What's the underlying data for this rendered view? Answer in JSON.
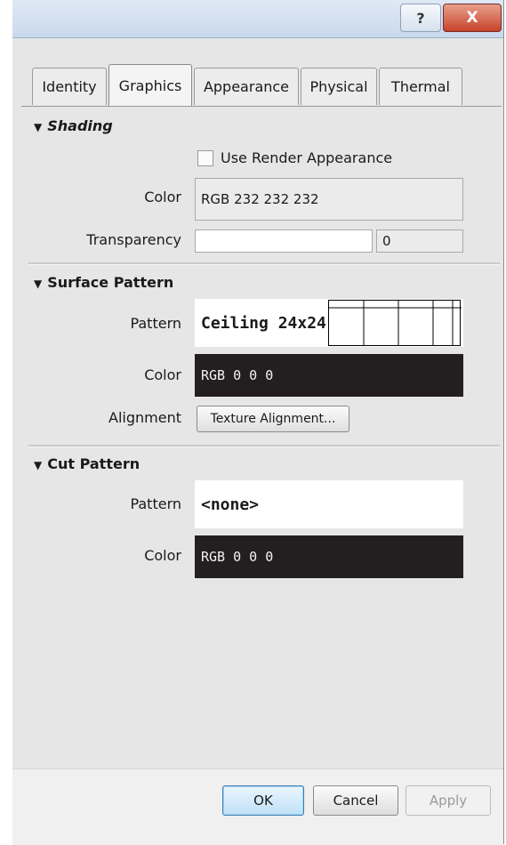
{
  "window": {
    "help_label": "?",
    "close_label": "X"
  },
  "tabs": [
    {
      "label": "Identity"
    },
    {
      "label": "Graphics"
    },
    {
      "label": "Appearance"
    },
    {
      "label": "Physical"
    },
    {
      "label": "Thermal"
    }
  ],
  "shading": {
    "title": "Shading",
    "use_render_label": "Use Render Appearance",
    "color_label": "Color",
    "color_value": "RGB 232 232 232",
    "transparency_label": "Transparency",
    "transparency_value": "0"
  },
  "surface_pattern": {
    "title": "Surface Pattern",
    "pattern_label": "Pattern",
    "pattern_value": "Ceiling 24x24",
    "color_label": "Color",
    "color_value": "RGB 0 0 0",
    "alignment_label": "Alignment",
    "alignment_button": "Texture Alignment..."
  },
  "cut_pattern": {
    "title": "Cut Pattern",
    "pattern_label": "Pattern",
    "pattern_value": "<none>",
    "color_label": "Color",
    "color_value": "RGB 0 0 0"
  },
  "buttons": {
    "ok": "OK",
    "cancel": "Cancel",
    "apply": "Apply"
  },
  "colors": {
    "shading_color": "#e8e8e8",
    "pattern_color": "#000000"
  }
}
